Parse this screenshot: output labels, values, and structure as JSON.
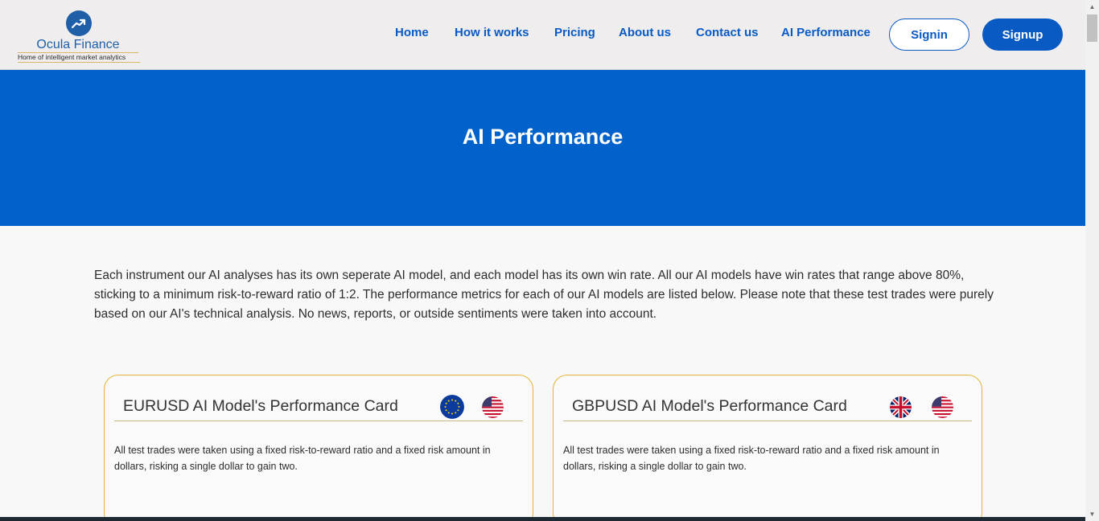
{
  "brand": {
    "name": "Ocula Finance",
    "tagline": "Home of intelligent market analytics"
  },
  "nav": {
    "home": "Home",
    "how_it_works": "How it works",
    "pricing": "Pricing",
    "about_us": "About us",
    "contact_us": "Contact us",
    "ai_performance": "AI Performance",
    "signin": "Signin",
    "signup": "Signup"
  },
  "hero": {
    "title": "AI Performance"
  },
  "intro": {
    "text": "Each instrument our AI analyses has its own seperate AI model, and each model has its own win rate. All our AI models have win rates that range above 80%, sticking to a minimum risk-to-reward ratio of 1:2. The performance metrics for each of our AI models are listed below. Please note that these test trades were purely based on our AI's technical analysis. No news, reports, or outside sentiments were taken into account."
  },
  "cards": [
    {
      "title": "EURUSD AI Model's Performance Card",
      "description": "All test trades were taken using a fixed risk-to-reward ratio and a fixed risk amount in dollars, risking a single dollar to gain two.",
      "flags": [
        "eu-flag-icon",
        "us-flag-icon"
      ]
    },
    {
      "title": "GBPUSD AI Model's Performance Card",
      "description": "All test trades were taken using a fixed risk-to-reward ratio and a fixed risk amount in dollars, risking a single dollar to gain two.",
      "flags": [
        "uk-flag-icon",
        "us-flag-icon"
      ]
    }
  ],
  "colors": {
    "primary": "#0a5ac4",
    "hero_bg": "#0262cc",
    "header_bg": "#efeded",
    "card_border": "#e3b437"
  }
}
